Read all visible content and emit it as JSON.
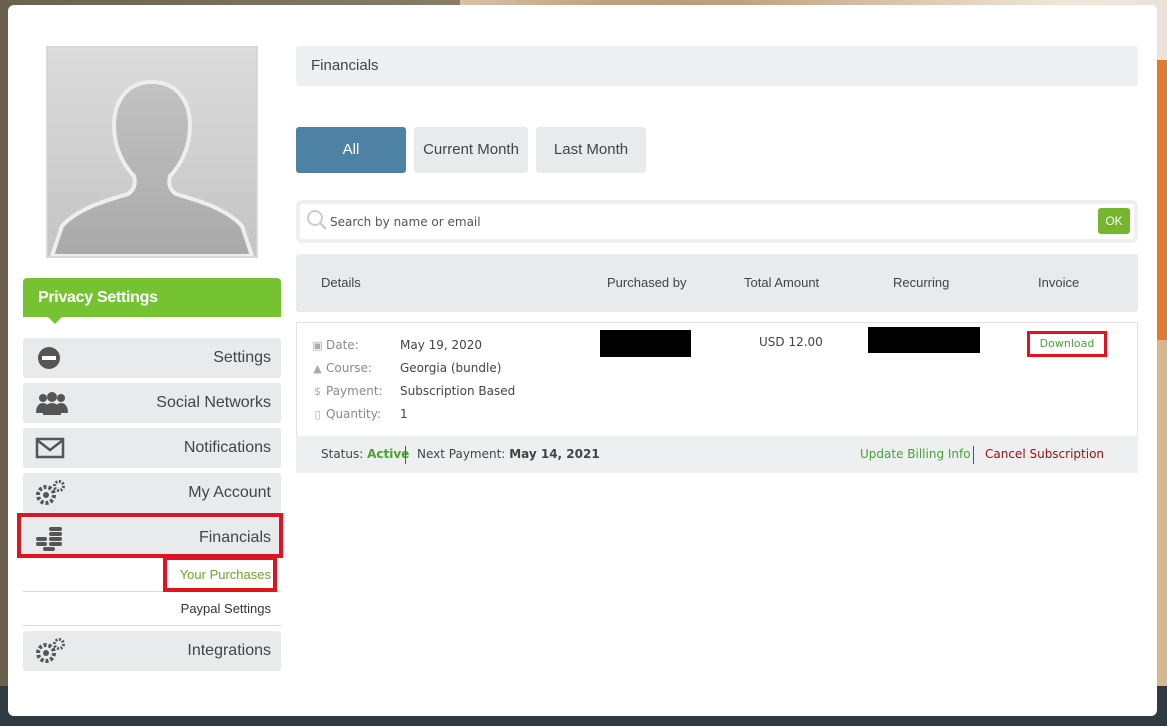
{
  "colors": {
    "accent_green": "#76c332",
    "tab_active": "#4e82a5",
    "highlight_red": "#e0141e",
    "link_green": "#4aa233",
    "cancel_red": "#8f1019"
  },
  "sidebar": {
    "privacy_header": "Privacy Settings",
    "items": [
      {
        "label": "Settings",
        "icon": "minus-circle-icon"
      },
      {
        "label": "Social Networks",
        "icon": "users-icon"
      },
      {
        "label": "Notifications",
        "icon": "envelope-icon"
      },
      {
        "label": "My Account",
        "icon": "gears-icon"
      },
      {
        "label": "Financials",
        "icon": "coins-icon"
      },
      {
        "label": "Integrations",
        "icon": "gears-icon"
      }
    ],
    "sub_items": [
      {
        "label": "Your Purchases",
        "active": true
      },
      {
        "label": "Paypal Settings",
        "active": false
      }
    ]
  },
  "main": {
    "title": "Financials",
    "tabs": [
      {
        "label": "All",
        "active": true
      },
      {
        "label": "Current Month",
        "active": false
      },
      {
        "label": "Last Month",
        "active": false
      }
    ],
    "search": {
      "placeholder": "Search by name or email",
      "value": "",
      "ok_label": "OK"
    },
    "table": {
      "headers": [
        "Details",
        "Purchased by",
        "Total Amount",
        "Recurring",
        "Invoice"
      ],
      "row": {
        "details": [
          {
            "label": "Date:",
            "value": "May 19, 2020",
            "icon": "calendar-icon"
          },
          {
            "label": "Course:",
            "value": "Georgia (bundle)",
            "icon": "graduation-cap-icon"
          },
          {
            "label": "Payment:",
            "value": "Subscription Based",
            "icon": "dollar-icon"
          },
          {
            "label": "Quantity:",
            "value": "1",
            "icon": "stack-icon"
          }
        ],
        "total_amount": "USD 12.00",
        "invoice_link": "Download"
      },
      "status_bar": {
        "status_label": "Status:",
        "status_value": "Active",
        "next_payment_label": "Next Payment:",
        "next_payment_value": "May 14, 2021",
        "update_billing": "Update Billing Info",
        "cancel_subscription": "Cancel Subscription"
      }
    }
  }
}
